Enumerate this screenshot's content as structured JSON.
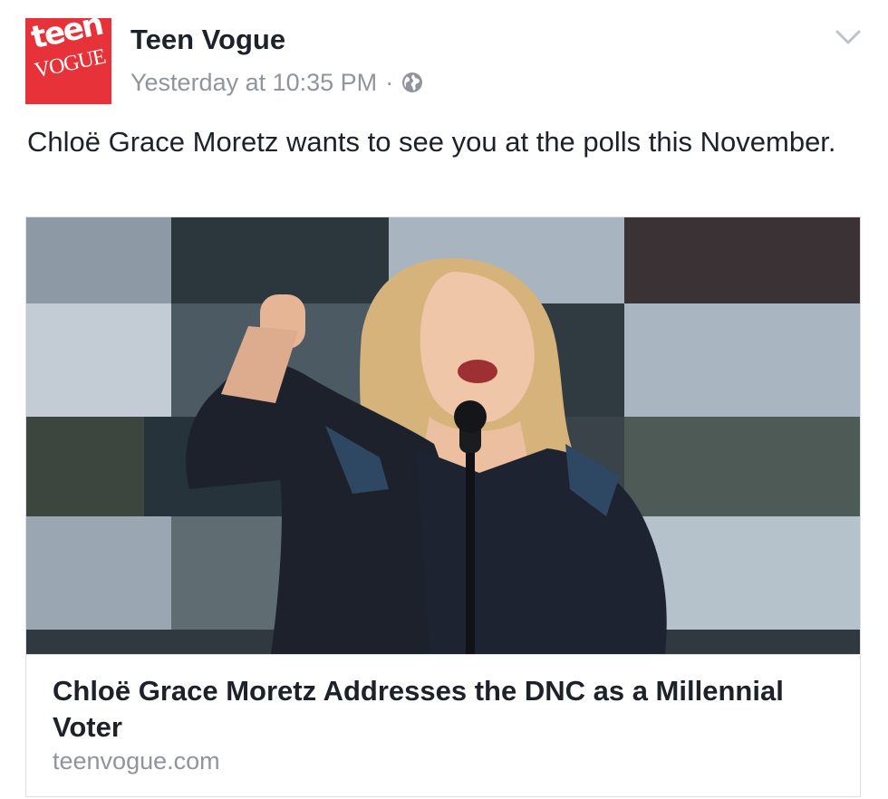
{
  "post": {
    "page_name": "Teen Vogue",
    "timestamp": "Yesterday at 10:35 PM",
    "separator": "·",
    "privacy_icon": "globe-icon",
    "menu_icon": "chevron-down-icon",
    "message": "Chloë Grace Moretz wants to see you at the polls this November."
  },
  "avatar": {
    "logo_top": "teen",
    "logo_bottom": "VOGUE",
    "background": "#e8323a"
  },
  "link_card": {
    "title": "Chloë Grace Moretz Addresses the DNC as a Millennial Voter",
    "domain": "teenvogue.com"
  },
  "colors": {
    "primary_text": "#1d2129",
    "secondary_text": "#90949c",
    "border": "#dddfe2"
  }
}
